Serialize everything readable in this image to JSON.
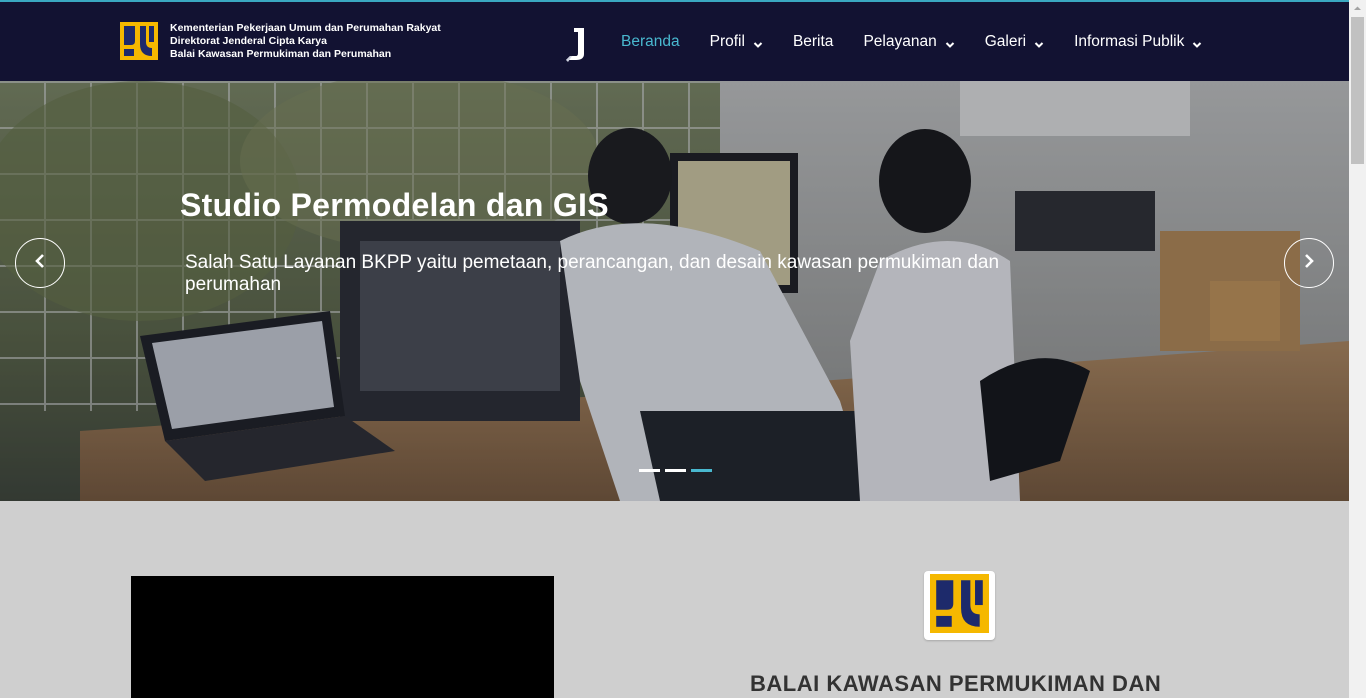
{
  "header": {
    "brand_lines": [
      "Kementerian Pekerjaan Umum dan Perumahan Rakyat",
      "Direktorat Jenderal Cipta Karya",
      "Balai Kawasan Permukiman dan Perumahan"
    ],
    "nav": [
      {
        "label": "Beranda",
        "active": true,
        "dropdown": false
      },
      {
        "label": "Profil",
        "active": false,
        "dropdown": true
      },
      {
        "label": "Berita",
        "active": false,
        "dropdown": false
      },
      {
        "label": "Pelayanan",
        "active": false,
        "dropdown": true
      },
      {
        "label": "Galeri",
        "active": false,
        "dropdown": true
      },
      {
        "label": "Informasi Publik",
        "active": false,
        "dropdown": true
      }
    ]
  },
  "hero": {
    "title": "Studio Permodelan dan GIS",
    "subtitle": "Salah Satu Layanan BKPP yaitu pemetaan, perancangan, dan desain kawasan permukiman dan perumahan",
    "slide_count": 3,
    "active_slide": 3
  },
  "content": {
    "balai_title": "BALAI KAWASAN PERMUKIMAN DAN"
  },
  "colors": {
    "navbar": "#121232",
    "accent": "#49b8cf",
    "pu_yellow": "#f5b800",
    "pu_navy": "#1d2a6b",
    "page_bg": "#cfcfcf"
  }
}
